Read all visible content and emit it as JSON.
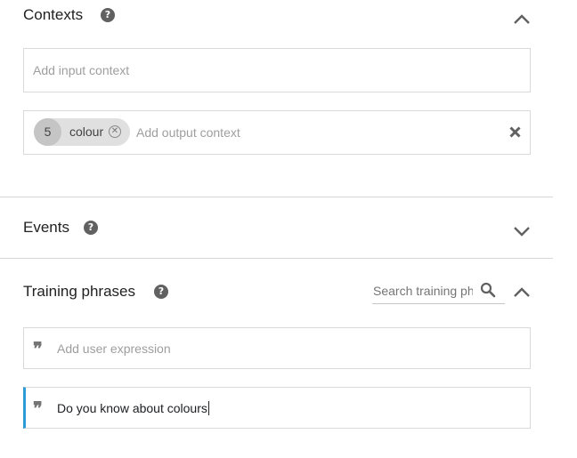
{
  "contexts": {
    "title": "Contexts",
    "input_placeholder": "Add input context",
    "output_chip": {
      "lifespan": "5",
      "name": "colour"
    },
    "output_placeholder": "Add output context"
  },
  "events": {
    "title": "Events"
  },
  "training": {
    "title": "Training phrases",
    "search_placeholder": "Search training phrases",
    "add_placeholder": "Add user expression",
    "phrases": [
      "Do you know about colours"
    ]
  },
  "colors": {
    "accent": "#2d9bd6",
    "icon": "#616161",
    "border": "#d9d9d9"
  },
  "icons": [
    "help-icon",
    "chevron-up-icon",
    "chevron-down-icon",
    "close-icon",
    "search-icon",
    "quote-icon"
  ]
}
